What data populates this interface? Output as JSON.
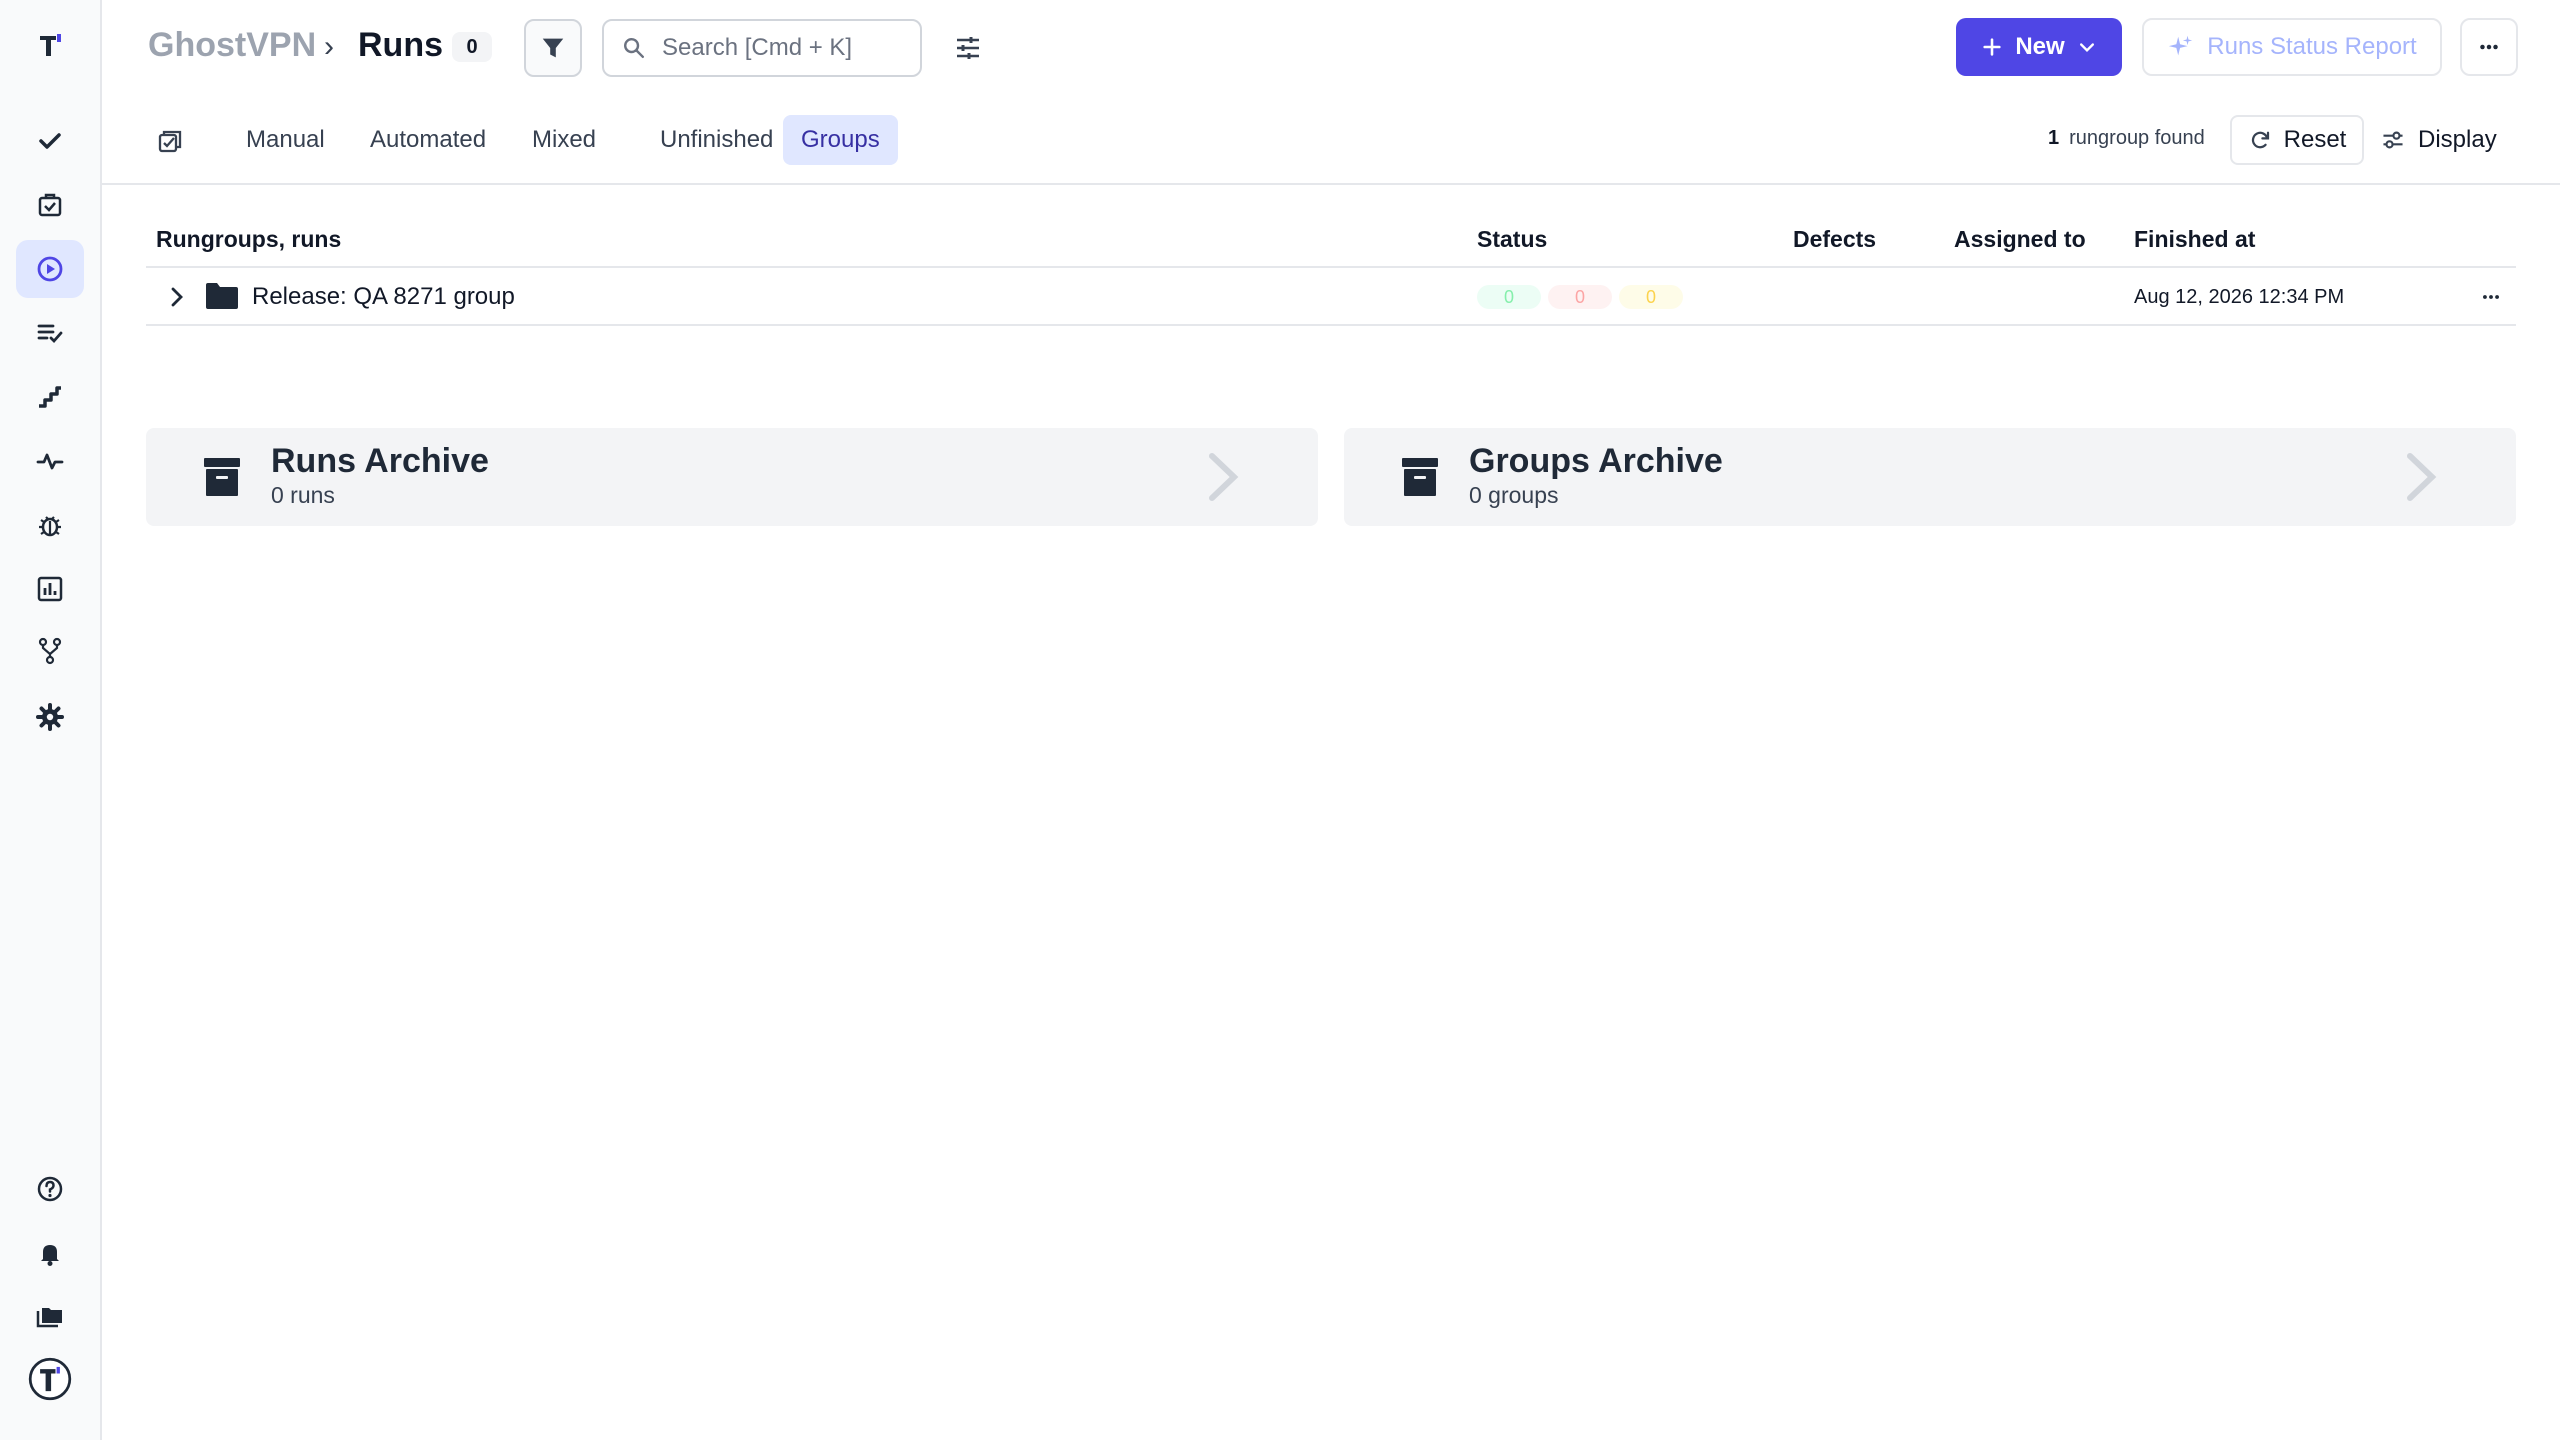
{
  "header": {
    "project": "GhostVPN",
    "separator": "›",
    "page": "Runs",
    "count": "0",
    "search_placeholder": "Search [Cmd + K]",
    "new_label": "New",
    "report_label": "Runs Status Report"
  },
  "tabs": [
    {
      "label": "Manual"
    },
    {
      "label": "Automated"
    },
    {
      "label": "Mixed"
    },
    {
      "label": "Unfinished"
    },
    {
      "label": "Groups"
    }
  ],
  "active_tab": "Groups",
  "results": {
    "count": "1",
    "label": "rungroup found",
    "reset_label": "Reset",
    "display_label": "Display"
  },
  "table": {
    "headers": {
      "name": "Rungroups, runs",
      "status": "Status",
      "defects": "Defects",
      "assigned": "Assigned to",
      "finished": "Finished at"
    },
    "rows": [
      {
        "title": "Release: QA 8271 group",
        "passed": "0",
        "failed": "0",
        "skipped": "0",
        "finished_at": "Aug 12, 2026 12:34 PM"
      }
    ]
  },
  "archives": {
    "runs": {
      "title": "Runs Archive",
      "subtitle": "0 runs"
    },
    "groups": {
      "title": "Groups Archive",
      "subtitle": "0 groups"
    }
  },
  "sidebar": {
    "items": [
      {
        "icon": "logo-icon"
      },
      {
        "icon": "check-icon"
      },
      {
        "icon": "clipboard-check-icon"
      },
      {
        "icon": "play-circle-icon",
        "active": true
      },
      {
        "icon": "list-check-icon"
      },
      {
        "icon": "steps-icon"
      },
      {
        "icon": "pulse-icon"
      },
      {
        "icon": "bug-icon"
      },
      {
        "icon": "bar-chart-icon"
      },
      {
        "icon": "branch-icon"
      },
      {
        "icon": "gear-icon"
      },
      {
        "icon": "help-icon"
      },
      {
        "icon": "bell-icon"
      },
      {
        "icon": "folders-icon"
      },
      {
        "icon": "avatar-icon"
      }
    ]
  },
  "colors": {
    "accent": "#4f46e5",
    "active_bg": "#e0e7ff",
    "sidebar_bg": "#f9fafb"
  }
}
